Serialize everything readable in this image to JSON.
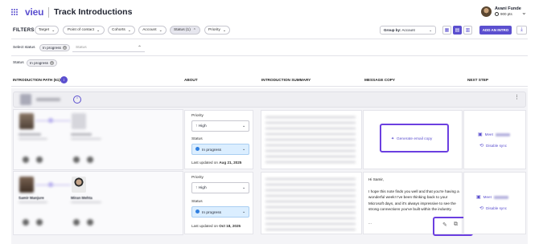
{
  "header": {
    "logo": "vieu",
    "title": "Track Introductions",
    "user_name": "Avani Funde",
    "user_points": "900 pts"
  },
  "filters": {
    "label": "FILTERS",
    "chips": [
      "Target",
      "Point of contact",
      "Cohorts",
      "Account",
      "Status (1)",
      "Priority"
    ],
    "group_by_label": "Group by:",
    "group_by_value": "Account",
    "add_intro": "ADD AN INTRO"
  },
  "select_status": {
    "label": "Select status",
    "selected": "In progress",
    "placeholder": "Status"
  },
  "status_filter": {
    "label": "Status",
    "value": "In progress"
  },
  "table": {
    "columns": {
      "path": "INTRODUCTION PATH (61)",
      "about": "ABOUT",
      "summary": "INTRODUCTION SUMMARY",
      "message": "MESSAGE COPY",
      "next": "NEXT STEP"
    },
    "rows": [
      {
        "priority_label": "Priority",
        "priority": "High",
        "status_label": "Status",
        "status": "In progress",
        "updated_prefix": "Last updated on",
        "updated_date": "Aug 21, 2025",
        "message_action": "Generate email copy",
        "next_meet": "Meet",
        "next_sync": "Disable sync"
      },
      {
        "person_a": "Samir Manjure",
        "person_b": "Miran Mehta",
        "priority_label": "Priority",
        "priority": "High",
        "status_label": "Status",
        "status": "In progress",
        "updated_prefix": "Last updated on",
        "updated_date": "Oct 18, 2025",
        "message_greeting": "Hi Samir,",
        "message_body": "I hope this note finds you well and that you're having a wonderful week! I've been thinking back to your Microsoft days, and it's always impressive to see the strong connections you've built within the industry.",
        "message_more": "...",
        "next_meet": "Meet",
        "next_sync": "Disable sync"
      }
    ]
  },
  "colors": {
    "accent": "#5b4fcf",
    "highlight": "#6b3fe0",
    "status_bg": "#dbeeff"
  }
}
